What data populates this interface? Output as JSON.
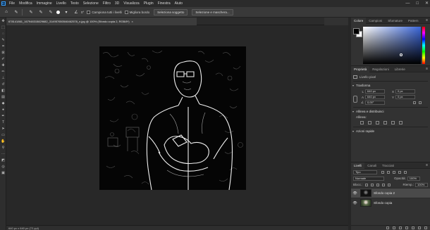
{
  "menu": {
    "logo": "Ps",
    "items": [
      "File",
      "Modifica",
      "Immagine",
      "Livello",
      "Testo",
      "Selezione",
      "Filtro",
      "3D",
      "Visualizza",
      "Plugin",
      "Finestra",
      "Aiuto"
    ],
    "window_controls": [
      "—",
      "□",
      "✕"
    ]
  },
  "options": {
    "angle": "0°",
    "sample_all_layers": "Campiona tutti i livelli",
    "enhance_edges": "Migliora bordo",
    "select_subject": "Seleziona soggetto",
    "select_mask": "Selezione e maschera..."
  },
  "document": {
    "tab_title": "678141861_167948315829682_314957650546462578_n.jpg @ 100% (Sfondo copia 2, RGB/8*)",
    "close": "×",
    "status": "640 px x 640 px (72 ppi)"
  },
  "color_panel": {
    "tabs": [
      "Colore",
      "Campioni",
      "Sfumature",
      "Pattern"
    ]
  },
  "properties_panel": {
    "tabs": [
      "Proprietà",
      "Regolazioni",
      "Librerie"
    ],
    "layer_type": "Livello pixel",
    "transform_title": "Trasforma",
    "w_label": "L",
    "w_value": "640 px",
    "h_label": "A",
    "h_value": "640 px",
    "x_label": "X",
    "x_value": "0 px",
    "y_label": "Y",
    "y_value": "0 px",
    "angle_value": "0,00°",
    "align_title": "Allinea e distribuisci",
    "align_label": "Allinea:",
    "quick_actions_title": "Azioni rapide"
  },
  "layers_panel": {
    "tabs": [
      "Livelli",
      "Canali",
      "Tracciati"
    ],
    "filter_value": "Tipo",
    "blend_mode": "Normale",
    "opacity_label": "Opacità:",
    "opacity_value": "100%",
    "lock_label": "Blocc.:",
    "fill_label": "Riemp.:",
    "fill_value": "100%",
    "layers": [
      {
        "name": "Sfondo copia 2",
        "visible": "👁",
        "selected": true
      },
      {
        "name": "Sfondo copia",
        "visible": "👁",
        "selected": false
      }
    ]
  }
}
